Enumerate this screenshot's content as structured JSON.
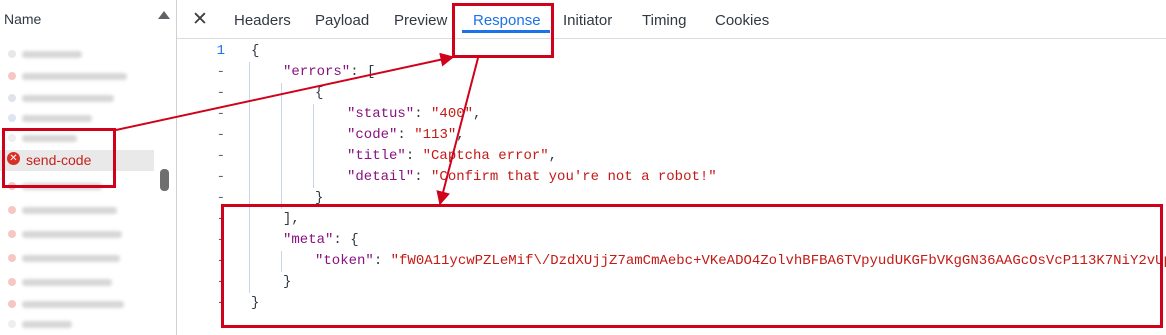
{
  "request_list": {
    "column_header": "Name",
    "selected_request": {
      "name": "send-code",
      "status": "error"
    }
  },
  "tabs": [
    {
      "label": "Headers"
    },
    {
      "label": "Payload"
    },
    {
      "label": "Preview"
    },
    {
      "label": "Response",
      "active": true
    },
    {
      "label": "Initiator"
    },
    {
      "label": "Timing"
    },
    {
      "label": "Cookies"
    }
  ],
  "response": {
    "gutter": {
      "first_line_number": "1",
      "other_marker": "-"
    },
    "lines": [
      {
        "tokens": [
          {
            "t": "pun",
            "v": "{"
          }
        ]
      },
      {
        "tokens": [
          {
            "t": "key",
            "v": "\"errors\""
          },
          {
            "t": "pun",
            "v": ": ["
          }
        ]
      },
      {
        "tokens": [
          {
            "t": "pun",
            "v": "{"
          }
        ]
      },
      {
        "tokens": [
          {
            "t": "key",
            "v": "\"status\""
          },
          {
            "t": "pun",
            "v": ": "
          },
          {
            "t": "str",
            "v": "\"400\""
          },
          {
            "t": "pun",
            "v": ","
          }
        ]
      },
      {
        "tokens": [
          {
            "t": "key",
            "v": "\"code\""
          },
          {
            "t": "pun",
            "v": ": "
          },
          {
            "t": "str",
            "v": "\"113\""
          },
          {
            "t": "pun",
            "v": ","
          }
        ]
      },
      {
        "tokens": [
          {
            "t": "key",
            "v": "\"title\""
          },
          {
            "t": "pun",
            "v": ": "
          },
          {
            "t": "str",
            "v": "\"Captcha error\""
          },
          {
            "t": "pun",
            "v": ","
          }
        ]
      },
      {
        "tokens": [
          {
            "t": "key",
            "v": "\"detail\""
          },
          {
            "t": "pun",
            "v": ": "
          },
          {
            "t": "str",
            "v": "\"Confirm that you're not a robot!\""
          }
        ]
      },
      {
        "tokens": [
          {
            "t": "pun",
            "v": "}"
          }
        ]
      },
      {
        "tokens": [
          {
            "t": "pun",
            "v": "],"
          }
        ]
      },
      {
        "tokens": [
          {
            "t": "key",
            "v": "\"meta\""
          },
          {
            "t": "pun",
            "v": ": {"
          }
        ]
      },
      {
        "tokens": [
          {
            "t": "key",
            "v": "\"token\""
          },
          {
            "t": "pun",
            "v": ": "
          },
          {
            "t": "str",
            "v": "\"fW0A11ycwPZLeMif\\/DzdXUjjZ7amCmAebc+VKeADO4ZolvhBFBA6TVpyudUKGFbVKgGN36AAGcOsVcP113K7NiY2vUp"
          }
        ]
      },
      {
        "tokens": [
          {
            "t": "pun",
            "v": "}"
          }
        ]
      },
      {
        "tokens": [
          {
            "t": "pun",
            "v": "}"
          }
        ]
      }
    ]
  },
  "colors": {
    "annotation_red": "#d0021b",
    "active_tab_blue": "#1a73e8",
    "json_key": "#881280",
    "json_string": "#c41a16",
    "error_red": "#d93025"
  },
  "icons": {
    "close": "close-icon",
    "error": "error-circle-icon",
    "sort": "sort-arrow-icon"
  }
}
